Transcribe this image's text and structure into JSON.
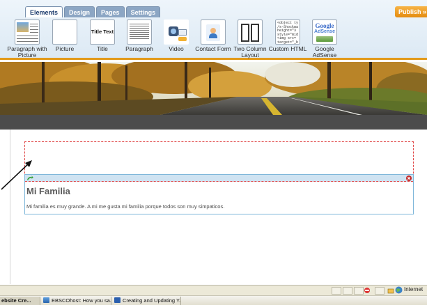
{
  "toolbar": {
    "tabs": [
      {
        "label": "Elements",
        "active": true
      },
      {
        "label": "Design",
        "active": false
      },
      {
        "label": "Pages",
        "active": false
      },
      {
        "label": "Settings",
        "active": false
      }
    ],
    "publish_label": "Publish »",
    "tools": [
      {
        "label": "Paragraph with Picture",
        "icon": "paragraph-with-picture-icon"
      },
      {
        "label": "Picture",
        "icon": "picture-icon"
      },
      {
        "label": "Title",
        "icon": "title-icon",
        "icon_text": "Title Text"
      },
      {
        "label": "Paragraph",
        "icon": "paragraph-icon"
      },
      {
        "label": "Video",
        "icon": "video-icon"
      },
      {
        "label": "Contact Form",
        "icon": "contact-form-icon"
      },
      {
        "label": "Two Column Layout",
        "icon": "two-column-layout-icon"
      },
      {
        "label": "Custom HTML",
        "icon": "custom-html-icon",
        "icon_text": "<object ty\n/s-Shockwa\nheight=\"3\nstyle=\"mid\n<img src=\ntarget=\"_b"
      },
      {
        "label": "Google AdSense",
        "icon": "google-adsense-icon",
        "icon_text_1": "Google",
        "icon_text_2": "AdSense"
      }
    ]
  },
  "content": {
    "block": {
      "title": "Mi Familia",
      "body": "Mi familia es muy grande. A mi me gusta mi familia porque todos son muy simpaticos."
    }
  },
  "statusbar": {
    "zone_label": "Internet"
  },
  "taskbar": {
    "tasks": [
      {
        "label": "ebsite Cre...",
        "active": true
      },
      {
        "label": "EBSCOhost: How you sa...",
        "active": false
      },
      {
        "label": "Creating and Updating Y...",
        "active": false
      }
    ]
  },
  "colors": {
    "accent_orange": "#e39a1a",
    "tab_blue": "#8ca6c4",
    "dashed_red": "#e04747",
    "block_border": "#7fb7da"
  }
}
